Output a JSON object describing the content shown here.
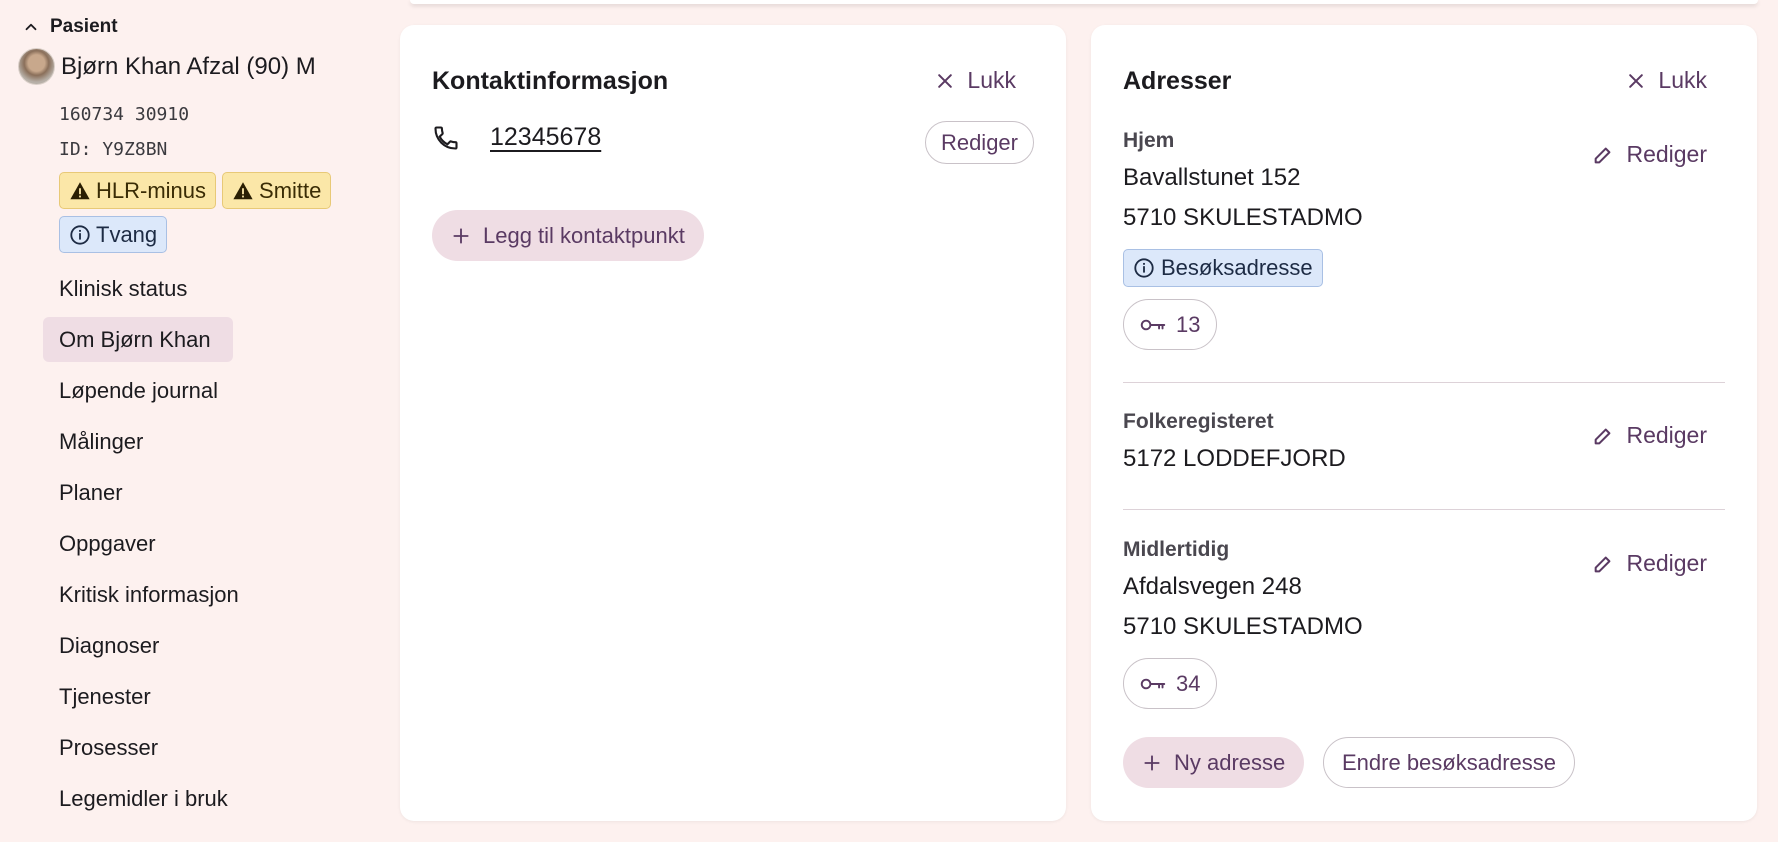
{
  "sidebar": {
    "section_title": "Pasient",
    "patient": {
      "name": "Bjørn Khan Afzal (90) M",
      "ssn": "160734 30910",
      "id": "ID: Y9Z8BN"
    },
    "badges": [
      {
        "label": "HLR-minus",
        "kind": "warning"
      },
      {
        "label": "Smitte",
        "kind": "warning"
      },
      {
        "label": "Tvang",
        "kind": "info"
      }
    ],
    "nav": [
      {
        "label": "Klinisk status"
      },
      {
        "label": "Om Bjørn Khan",
        "active": true
      },
      {
        "label": "Løpende journal"
      },
      {
        "label": "Målinger"
      },
      {
        "label": "Planer"
      },
      {
        "label": "Oppgaver"
      },
      {
        "label": "Kritisk informasjon"
      },
      {
        "label": "Diagnoser"
      },
      {
        "label": "Tjenester"
      },
      {
        "label": "Prosesser"
      },
      {
        "label": "Legemidler i bruk"
      }
    ]
  },
  "contact_card": {
    "title": "Kontaktinformasjon",
    "close_label": "Lukk",
    "phone": "12345678",
    "edit_label": "Rediger",
    "add_label": "Legg til kontaktpunkt"
  },
  "address_card": {
    "title": "Adresser",
    "close_label": "Lukk",
    "addresses": [
      {
        "label": "Hjem",
        "line1": "Bavallstunet 152",
        "line2": "5710 SKULESTADMO",
        "tag": "Besøksadresse",
        "key_count": "13",
        "edit_label": "Rediger"
      },
      {
        "label": "Folkeregisteret",
        "line1": "5172 LODDEFJORD",
        "edit_label": "Rediger"
      },
      {
        "label": "Midlertidig",
        "line1": "Afdalsvegen 248",
        "line2": "5710 SKULESTADMO",
        "key_count": "34",
        "edit_label": "Rediger"
      }
    ],
    "new_address_label": "Ny adresse",
    "change_visit_label": "Endre besøksadresse"
  },
  "colors": {
    "background": "#fdf1ef",
    "accent": "#5a3a63",
    "tonal": "#efdde4",
    "warning_bg": "#fbe7a8",
    "info_bg": "#dce8fa"
  },
  "icons": [
    "chevron-up-icon",
    "warning-icon",
    "info-icon",
    "phone-icon",
    "close-icon",
    "plus-icon",
    "pencil-icon",
    "key-icon"
  ]
}
